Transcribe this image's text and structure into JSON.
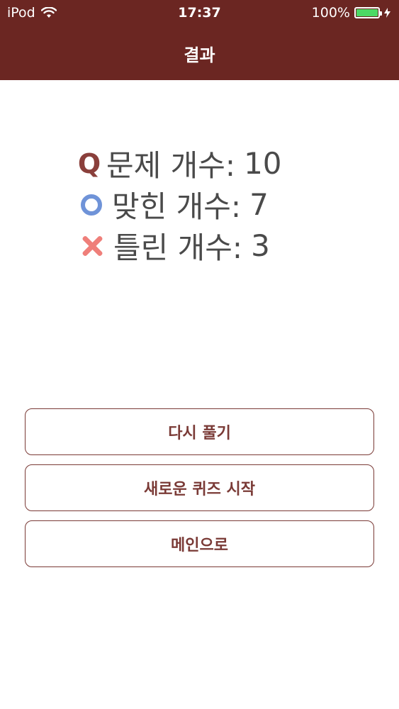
{
  "status_bar": {
    "device": "iPod",
    "time": "17:37",
    "battery": "100%",
    "battery_level": 1.0,
    "wifi_icon": "wifi-icon",
    "charging_icon": "bolt-icon"
  },
  "nav": {
    "title": "결과"
  },
  "results": {
    "questions": {
      "icon": "Q",
      "label": "문제 개수:",
      "value": "10"
    },
    "correct": {
      "icon": "circle-icon",
      "label": "맞힌 개수:",
      "value": "7"
    },
    "wrong": {
      "icon": "x-icon",
      "label": "틀린 개수:",
      "value": "3"
    }
  },
  "buttons": {
    "retry": "다시 풀기",
    "new_quiz": "새로운 퀴즈 시작",
    "main": "메인으로"
  },
  "colors": {
    "nav_bg": "#6b2622",
    "button_text": "#7a3a36",
    "correct_icon": "#6f93d8",
    "wrong_icon": "#ef7f7a",
    "battery_fill": "#4cd964"
  }
}
